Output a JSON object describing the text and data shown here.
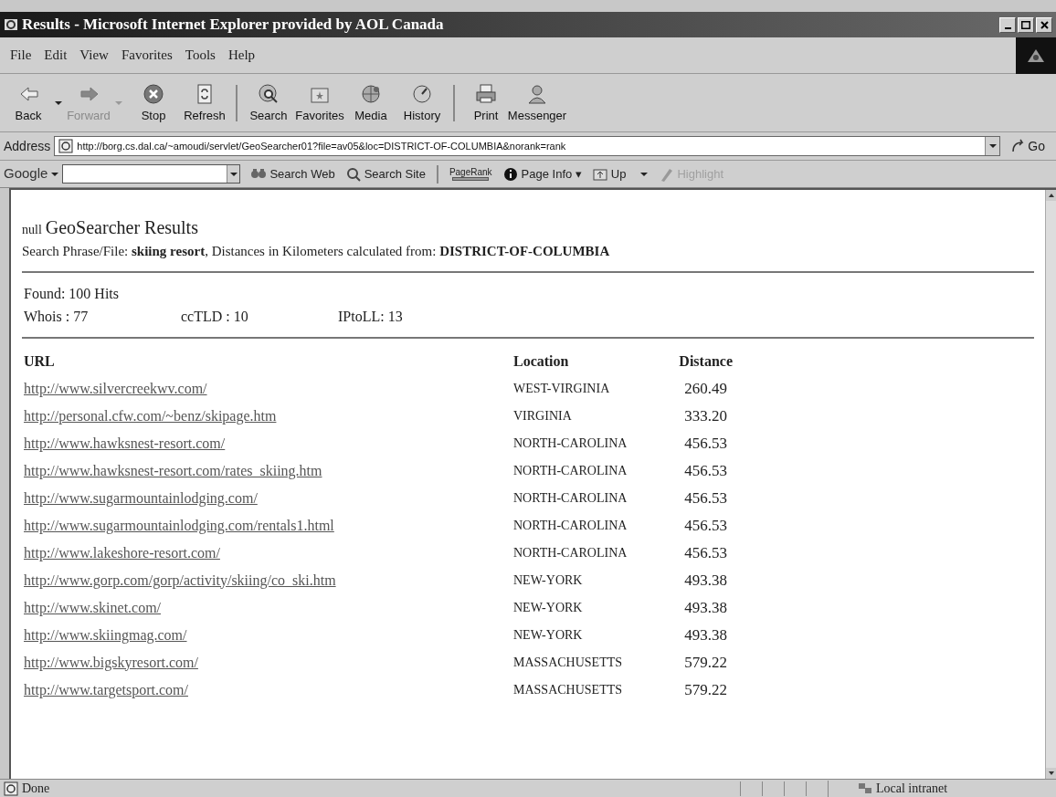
{
  "window": {
    "title": "Results - Microsoft Internet Explorer provided by AOL Canada"
  },
  "menu": [
    "File",
    "Edit",
    "View",
    "Favorites",
    "Tools",
    "Help"
  ],
  "toolbar": [
    {
      "label": "Back",
      "kind": "back",
      "disabled": false,
      "dropdown": true
    },
    {
      "label": "Forward",
      "kind": "forward",
      "disabled": true,
      "dropdown": true
    },
    {
      "label": "Stop",
      "kind": "stop",
      "disabled": false,
      "dropdown": false
    },
    {
      "label": "Refresh",
      "kind": "refresh",
      "disabled": false,
      "dropdown": false
    },
    {
      "label": "Search",
      "kind": "search",
      "disabled": false,
      "dropdown": false
    },
    {
      "label": "Favorites",
      "kind": "favorites",
      "disabled": false,
      "dropdown": false
    },
    {
      "label": "Media",
      "kind": "media",
      "disabled": false,
      "dropdown": false
    },
    {
      "label": "History",
      "kind": "history",
      "disabled": false,
      "dropdown": false
    },
    {
      "label": "Print",
      "kind": "print",
      "disabled": false,
      "dropdown": false
    },
    {
      "label": "Messenger",
      "kind": "messenger",
      "disabled": false,
      "dropdown": false
    }
  ],
  "address": {
    "label": "Address",
    "value": "http://borg.cs.dal.ca/~amoudi/servlet/GeoSearcher01?file=av05&loc=DISTRICT-OF-COLUMBIA&norank=rank",
    "go": "Go"
  },
  "google_bar": {
    "logo": "Google",
    "items": [
      {
        "label": "Search Web",
        "kind": "searchweb",
        "disabled": false
      },
      {
        "label": "Search Site",
        "kind": "searchsite",
        "disabled": false
      },
      {
        "label": "PageRank",
        "kind": "pagerank",
        "disabled": false
      },
      {
        "label": "Page Info ▾",
        "kind": "info",
        "disabled": false
      },
      {
        "label": "Up",
        "kind": "up",
        "disabled": false
      },
      {
        "label": "Highlight",
        "kind": "highlight",
        "disabled": true
      }
    ]
  },
  "page": {
    "prefix": "null",
    "title": "GeoSearcher Results",
    "subtitle": "Search Phrase/File: **skiing resort**, Distances in Kilometers calculated from: **DISTRICT-OF-COLUMBIA**",
    "found": "Found: 100 Hits",
    "stats": [
      "Whois : 77",
      "ccTLD : 10",
      "IPtoLL: 13"
    ],
    "table": {
      "columns": [
        "URL",
        "Location",
        "Distance"
      ],
      "rows": [
        [
          "http://www.silvercreekwv.com/",
          "WEST-VIRGINIA",
          "260.49"
        ],
        [
          "http://personal.cfw.com/~benz/skipage.htm",
          "VIRGINIA",
          "333.20"
        ],
        [
          "http://www.hawksnest-resort.com/",
          "NORTH-CAROLINA",
          "456.53"
        ],
        [
          "http://www.hawksnest-resort.com/rates_skiing.htm",
          "NORTH-CAROLINA",
          "456.53"
        ],
        [
          "http://www.sugarmountainlodging.com/",
          "NORTH-CAROLINA",
          "456.53"
        ],
        [
          "http://www.sugarmountainlodging.com/rentals1.html",
          "NORTH-CAROLINA",
          "456.53"
        ],
        [
          "http://www.lakeshore-resort.com/",
          "NORTH-CAROLINA",
          "456.53"
        ],
        [
          "http://www.gorp.com/gorp/activity/skiing/co_ski.htm",
          "NEW-YORK",
          "493.38"
        ],
        [
          "http://www.skinet.com/",
          "NEW-YORK",
          "493.38"
        ],
        [
          "http://www.skiingmag.com/",
          "NEW-YORK",
          "493.38"
        ],
        [
          "http://www.bigskyresort.com/",
          "MASSACHUSETTS",
          "579.22"
        ],
        [
          "http://www.targetsport.com/",
          "MASSACHUSETTS",
          "579.22"
        ]
      ]
    }
  },
  "status_bar": {
    "status": "Done",
    "zone": "Local intranet"
  }
}
